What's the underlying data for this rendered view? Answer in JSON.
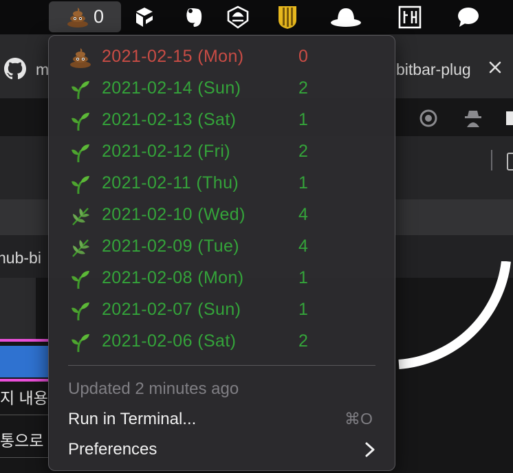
{
  "menubar": {
    "active_count": "0",
    "icons": [
      "poop-emoji",
      "linear-icon",
      "evernote-icon",
      "quickplan-icon",
      "shield-icon",
      "hat-icon",
      "hangul-icon",
      "chat-bubble-icon"
    ]
  },
  "background": {
    "tab_text_left": "m",
    "tab_text_right": "bitbar-plug",
    "path_fragment": "hub-bi",
    "korean_line1": "지 내용",
    "korean_line2": "통으로"
  },
  "menu": {
    "rows": [
      {
        "emoji": "poop",
        "date": "2021-02-15 (Mon)",
        "count": "0",
        "color": "#c94c45"
      },
      {
        "emoji": "seedling",
        "date": "2021-02-14 (Sun)",
        "count": "2",
        "color": "#34a43a"
      },
      {
        "emoji": "seedling",
        "date": "2021-02-13 (Sat)",
        "count": "1",
        "color": "#34a43a"
      },
      {
        "emoji": "seedling",
        "date": "2021-02-12 (Fri)",
        "count": "2",
        "color": "#34a43a"
      },
      {
        "emoji": "seedling",
        "date": "2021-02-11 (Thu)",
        "count": "1",
        "color": "#34a43a"
      },
      {
        "emoji": "herb",
        "date": "2021-02-10 (Wed)",
        "count": "4",
        "color": "#34a43a"
      },
      {
        "emoji": "herb",
        "date": "2021-02-09 (Tue)",
        "count": "4",
        "color": "#34a43a"
      },
      {
        "emoji": "seedling",
        "date": "2021-02-08 (Mon)",
        "count": "1",
        "color": "#34a43a"
      },
      {
        "emoji": "seedling",
        "date": "2021-02-07 (Sun)",
        "count": "1",
        "color": "#34a43a"
      },
      {
        "emoji": "seedling",
        "date": "2021-02-06 (Sat)",
        "count": "2",
        "color": "#34a43a"
      }
    ],
    "updated": "Updated 2 minutes ago",
    "run_in_terminal": "Run in Terminal...",
    "run_shortcut": "⌘O",
    "preferences": "Preferences"
  }
}
